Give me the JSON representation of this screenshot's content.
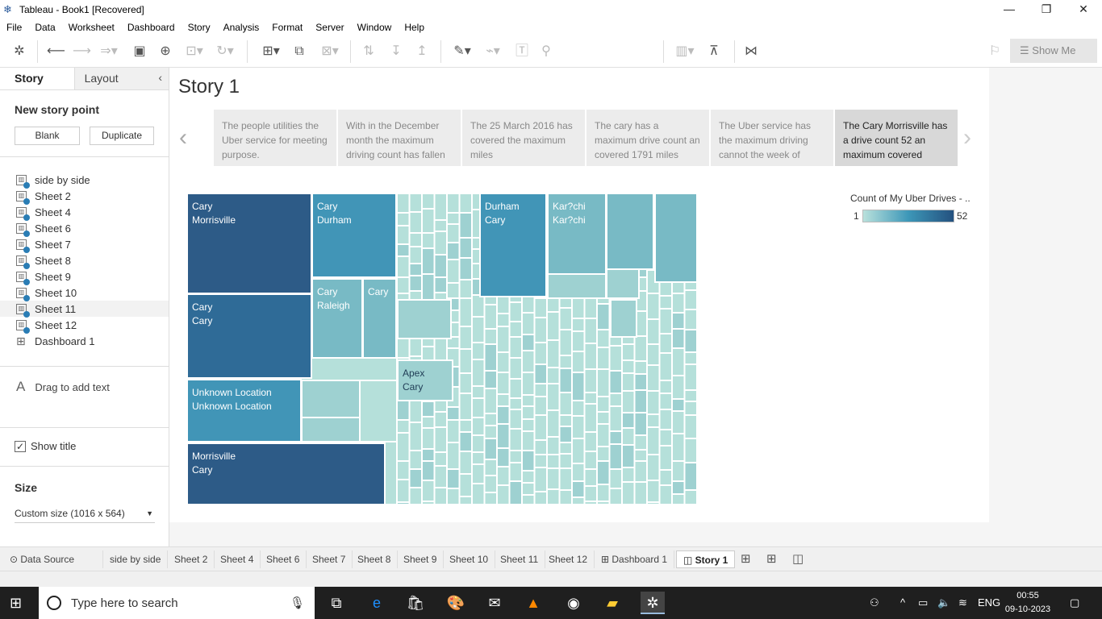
{
  "window": {
    "title": "Tableau - Book1 [Recovered]"
  },
  "menu": [
    "File",
    "Data",
    "Worksheet",
    "Dashboard",
    "Story",
    "Analysis",
    "Format",
    "Server",
    "Window",
    "Help"
  ],
  "toolbar": {
    "show_me": "Show Me"
  },
  "sidebar": {
    "tabs": {
      "story": "Story",
      "layout": "Layout"
    },
    "new_story_point": "New story point",
    "blank": "Blank",
    "duplicate": "Duplicate",
    "sheets": [
      {
        "label": "side by side"
      },
      {
        "label": "Sheet 2"
      },
      {
        "label": "Sheet 4"
      },
      {
        "label": "Sheet 6"
      },
      {
        "label": "Sheet 7"
      },
      {
        "label": "Sheet 8"
      },
      {
        "label": "Sheet 9"
      },
      {
        "label": "Sheet 10"
      },
      {
        "label": "Sheet 11"
      },
      {
        "label": "Sheet 12"
      },
      {
        "label": "Dashboard 1"
      }
    ],
    "drag_text": "Drag to add text",
    "show_title": "Show title",
    "size_label": "Size",
    "size_value": "Custom size (1016 x 564)"
  },
  "story": {
    "title": "Story 1",
    "points": [
      "The people utilities the Uber service for meeting purpose.",
      "With in the December month the maximum driving count has fallen",
      "The 25 March 2016 has covered the maximum miles",
      "The cary has a maximum drive count an covered 1791 miles",
      "The Uber service has the maximum driving cannot the week of",
      "The Cary Morrisville has a drive count 52 an maximum covered"
    ]
  },
  "treemap": {
    "labels": [
      [
        "Cary",
        "Morrisville"
      ],
      [
        "Cary",
        "Durham"
      ],
      [
        "Durham",
        "Cary"
      ],
      [
        "Kar?chi",
        "Kar?chi"
      ],
      [
        "Cary",
        "Raleigh"
      ],
      [
        "Cary"
      ],
      [
        "Cary",
        "Cary"
      ],
      [
        "Apex",
        "Cary"
      ],
      [
        "Unknown Location",
        "Unknown Location"
      ],
      [
        "Morrisville",
        "Cary"
      ]
    ]
  },
  "legend": {
    "title": "Count of My Uber Drives - ..",
    "min": "1",
    "max": "52"
  },
  "colors": {
    "dark": "#2d5b87",
    "mid_dark": "#2f6b97",
    "mid": "#4195b7",
    "light_mid": "#78bac5",
    "light": "#9ed1d1",
    "pale": "#b5e0da"
  },
  "tabs": [
    "Data Source",
    "side by side",
    "Sheet 2",
    "Sheet 4",
    "Sheet 6",
    "Sheet 7",
    "Sheet 8",
    "Sheet 9",
    "Sheet 10",
    "Sheet 11",
    "Sheet 12",
    "Dashboard 1",
    "Story 1"
  ],
  "taskbar": {
    "search_placeholder": "Type here to search",
    "lang": "ENG",
    "time": "00:55",
    "date": "09-10-2023"
  }
}
